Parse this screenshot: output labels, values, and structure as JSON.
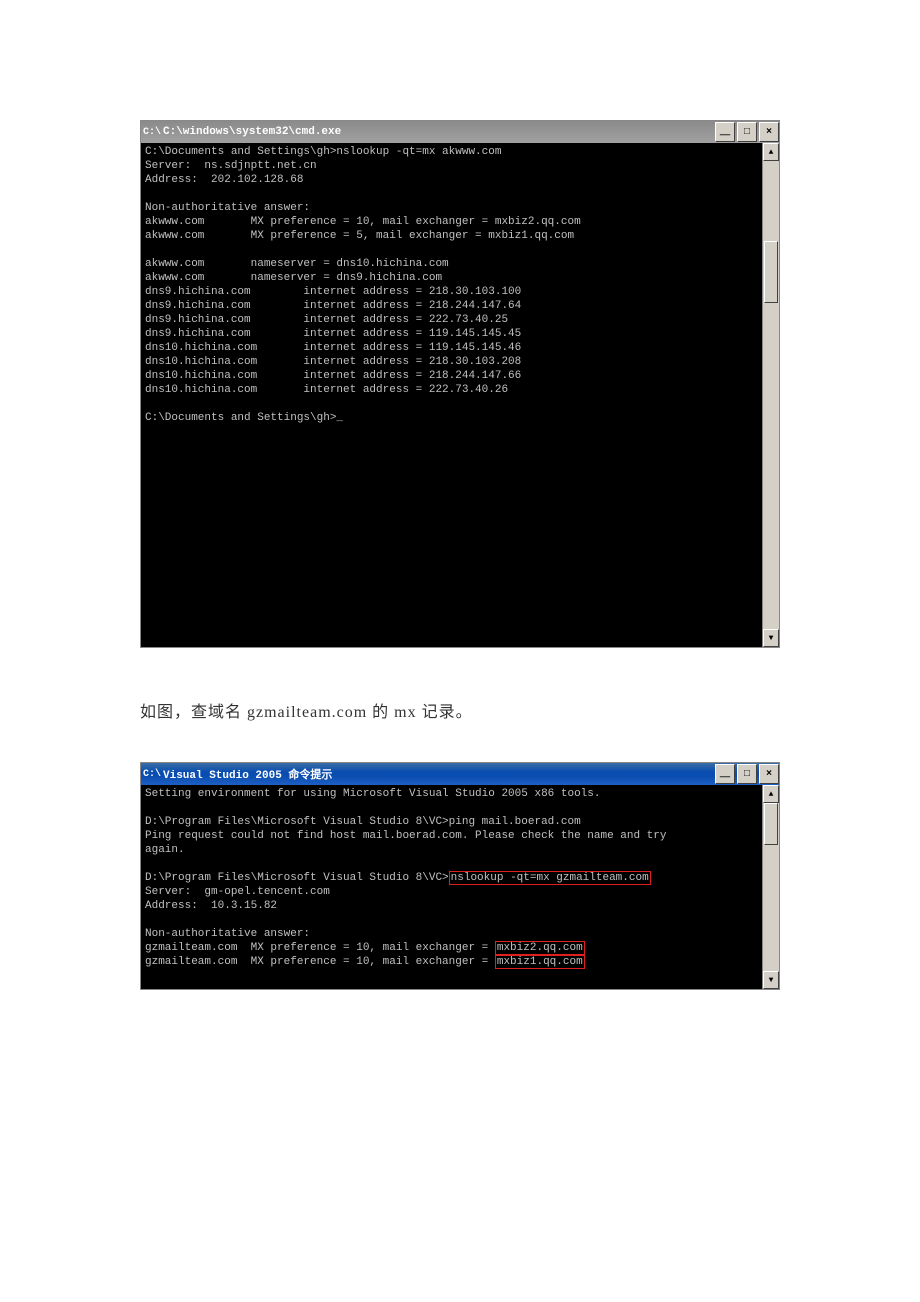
{
  "window1": {
    "title_icon": "C:\\",
    "title": "C:\\windows\\system32\\cmd.exe",
    "body_lines": [
      "C:\\Documents and Settings\\gh>nslookup -qt=mx akwww.com",
      "Server:  ns.sdjnptt.net.cn",
      "Address:  202.102.128.68",
      "",
      "Non-authoritative answer:",
      "akwww.com       MX preference = 10, mail exchanger = mxbiz2.qq.com",
      "akwww.com       MX preference = 5, mail exchanger = mxbiz1.qq.com",
      "",
      "akwww.com       nameserver = dns10.hichina.com",
      "akwww.com       nameserver = dns9.hichina.com",
      "dns9.hichina.com        internet address = 218.30.103.100",
      "dns9.hichina.com        internet address = 218.244.147.64",
      "dns9.hichina.com        internet address = 222.73.40.25",
      "dns9.hichina.com        internet address = 119.145.145.45",
      "dns10.hichina.com       internet address = 119.145.145.46",
      "dns10.hichina.com       internet address = 218.30.103.208",
      "dns10.hichina.com       internet address = 218.244.147.66",
      "dns10.hichina.com       internet address = 222.73.40.26",
      "",
      "C:\\Documents and Settings\\gh>_"
    ]
  },
  "caption_text": "如图，查域名 gzmailteam.com 的 mx 记录。",
  "window2": {
    "title_icon": "C:\\",
    "title": "Visual Studio 2005 命令提示",
    "intro_line": "Setting environment for using Microsoft Visual Studio 2005 x86 tools.",
    "ping_prompt": "D:\\Program Files\\Microsoft Visual Studio 8\\VC>ping mail.boerad.com",
    "ping_fail1": "Ping request could not find host mail.boerad.com. Please check the name and try",
    "ping_fail2": "again.",
    "nslookup_prefix": "D:\\Program Files\\Microsoft Visual Studio 8\\VC>",
    "nslookup_cmd": "nslookup -qt=mx gzmailteam.com",
    "server_line": "Server:  gm-opel.tencent.com",
    "address_line": "Address:  10.3.15.82",
    "nonauth": "Non-authoritative answer:",
    "mx1_prefix": "gzmailteam.com  MX preference = 10, mail exchanger = ",
    "mx1_box": "mxbiz2.qq.com",
    "mx2_prefix": "gzmailteam.com  MX preference = 10, mail exchanger = ",
    "mx2_box": "mxbiz1.qq.com"
  },
  "win_buttons": {
    "minimize": "＿",
    "maximize": "□",
    "close": "×"
  },
  "scrollbar": {
    "up": "▲",
    "down": "▼"
  }
}
